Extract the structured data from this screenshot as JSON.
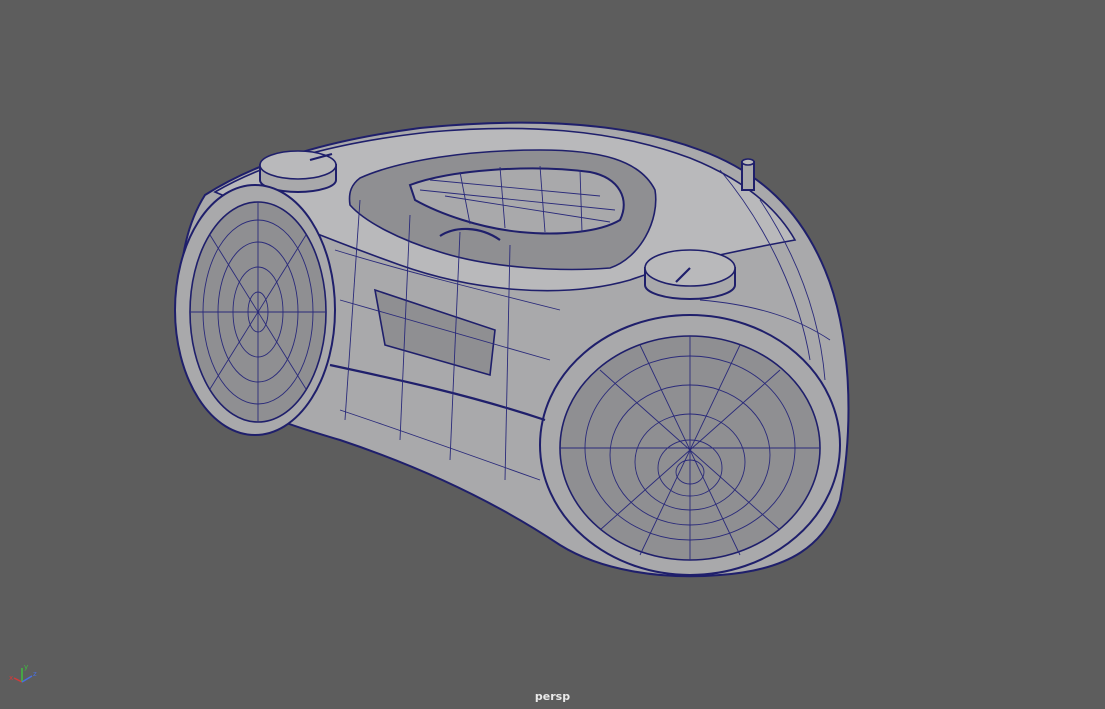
{
  "viewport": {
    "camera_name": "persp",
    "background_color": "#5d5d5d",
    "wireframe_color": "#1f1f6b",
    "shaded_color": "#a9a9ab"
  },
  "axis_gizmo": {
    "labels": [
      "x",
      "y",
      "z"
    ],
    "colors": {
      "x": "#d33a3a",
      "y": "#3fbf3f",
      "z": "#4a6fe0"
    }
  },
  "model": {
    "icon": "boombox-model"
  }
}
